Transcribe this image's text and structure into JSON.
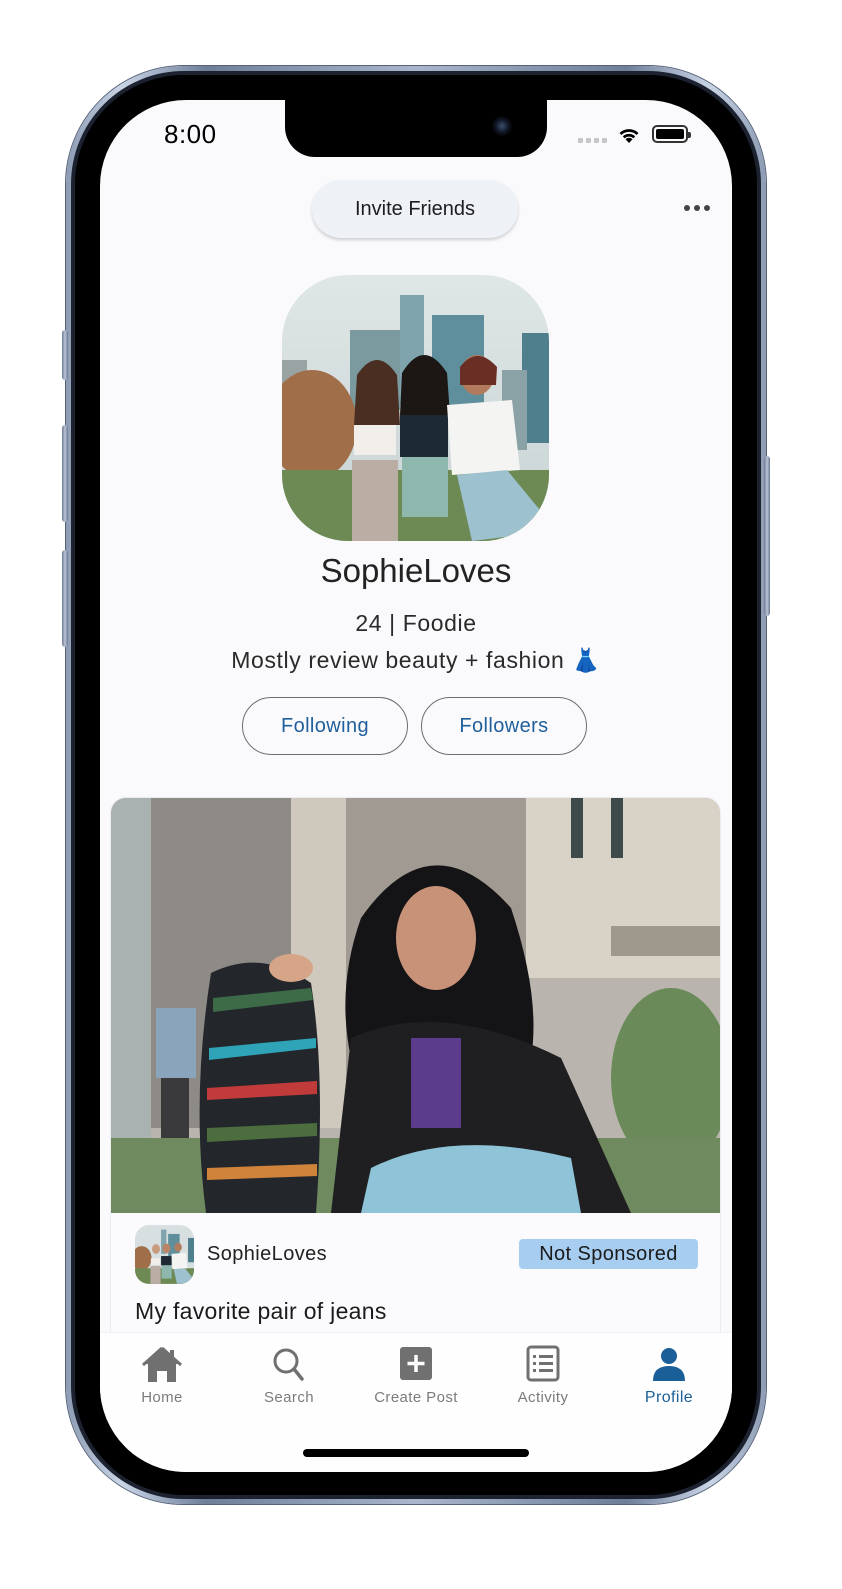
{
  "status_bar": {
    "time": "8:00",
    "signal_icon": "cellular-signal-icon",
    "wifi_icon": "wifi-icon",
    "battery_icon": "battery-icon"
  },
  "header": {
    "invite_button_label": "Invite Friends",
    "more_icon": "more-horizontal-icon"
  },
  "profile": {
    "avatar_alt": "Three friends posing in front of city skyline",
    "username": "SophieLoves",
    "meta": "24 | Foodie",
    "bio": "Mostly review beauty + fashion",
    "bio_emoji": "👗",
    "following_label": "Following",
    "followers_label": "Followers"
  },
  "post": {
    "image_alt": "Young woman holding a skateboard, wearing leather jacket and ripped jeans",
    "author": "SophieLoves",
    "badge": "Not Sponsored",
    "title": "My favorite pair of jeans",
    "colors": {
      "badge_bg": "#a7cdf0"
    }
  },
  "tabbar": {
    "items": [
      {
        "label": "Home",
        "icon": "home-icon",
        "active": false
      },
      {
        "label": "Search",
        "icon": "search-icon",
        "active": false
      },
      {
        "label": "Create Post",
        "icon": "plus-square-icon",
        "active": false
      },
      {
        "label": "Activity",
        "icon": "list-icon",
        "active": false
      },
      {
        "label": "Profile",
        "icon": "person-icon",
        "active": true
      }
    ],
    "colors": {
      "active": "#1b5f99",
      "inactive": "#7b7b7b"
    }
  }
}
